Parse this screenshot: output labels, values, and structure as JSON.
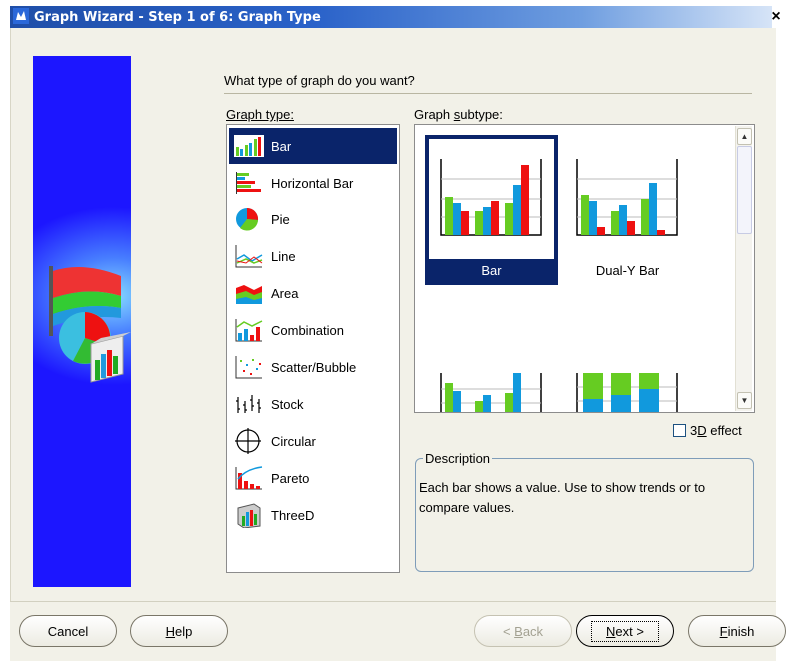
{
  "window": {
    "title": "Graph Wizard - Step 1 of 6: Graph Type",
    "close_glyph": "×"
  },
  "question": "What type of graph do you want?",
  "graph_type": {
    "label": "Graph type:",
    "items": [
      {
        "label": "Bar",
        "icon": "bar-chart-icon",
        "selected": true
      },
      {
        "label": "Horizontal Bar",
        "icon": "horizontal-bar-chart-icon"
      },
      {
        "label": "Pie",
        "icon": "pie-chart-icon"
      },
      {
        "label": "Line",
        "icon": "line-chart-icon"
      },
      {
        "label": "Area",
        "icon": "area-chart-icon"
      },
      {
        "label": "Combination",
        "icon": "combination-chart-icon"
      },
      {
        "label": "Scatter/Bubble",
        "icon": "scatter-chart-icon"
      },
      {
        "label": "Stock",
        "icon": "stock-chart-icon"
      },
      {
        "label": "Circular",
        "icon": "circular-chart-icon"
      },
      {
        "label": "Pareto",
        "icon": "pareto-chart-icon"
      },
      {
        "label": "ThreeD",
        "icon": "threed-chart-icon"
      }
    ]
  },
  "graph_subtype": {
    "label": "Graph subtype:",
    "items": [
      {
        "label": "Bar",
        "selected": true
      },
      {
        "label": "Dual-Y Bar"
      },
      {
        "label": ""
      },
      {
        "label": ""
      }
    ]
  },
  "effect_3d": {
    "label": "3D effect",
    "checked": false
  },
  "description": {
    "legend": "Description",
    "text": "Each bar shows a value. Use to show trends or to compare values."
  },
  "buttons": {
    "cancel": "Cancel",
    "help": "Help",
    "back": "Back",
    "next": "Next",
    "finish": "Finish"
  },
  "colors": {
    "selection": "#0a246a",
    "side_panel": "#1c16ff",
    "bar_green": "#66cc22",
    "bar_blue": "#1199dd",
    "bar_red": "#ee1111"
  }
}
